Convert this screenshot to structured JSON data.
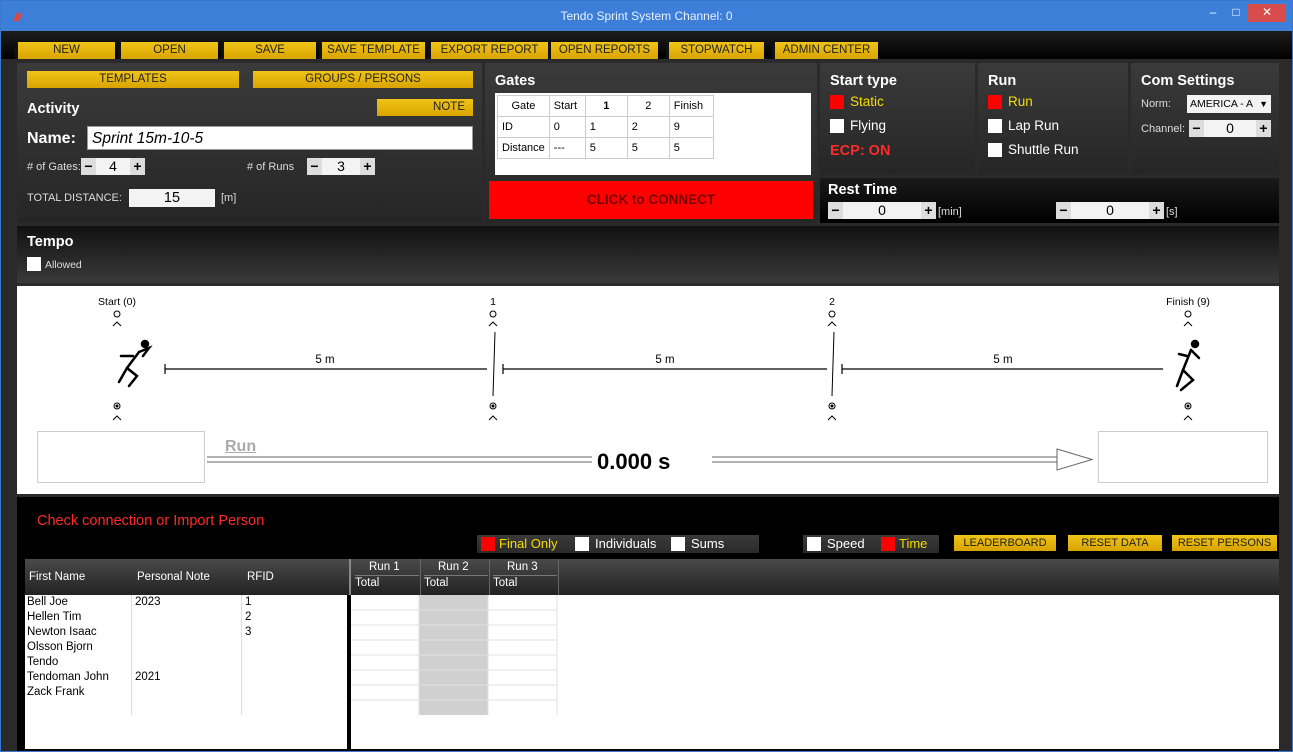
{
  "window": {
    "title": "Tendo Sprint System Channel: 0",
    "min_glyph": "–",
    "max_glyph": "□",
    "close_glyph": "✕"
  },
  "menu": [
    "NEW",
    "OPEN",
    "SAVE",
    "SAVE TEMPLATE",
    "EXPORT REPORT",
    "OPEN REPORTS",
    "STOPWATCH",
    "ADMIN CENTER"
  ],
  "activity": {
    "templates_label": "TEMPLATES",
    "groups_label": "GROUPS / PERSONS",
    "heading": "Activity",
    "note_label": "NOTE",
    "name_label": "Name:",
    "name_value": "Sprint 15m-10-5",
    "gates_label": "# of Gates:",
    "gates_value": "4",
    "runs_label": "# of Runs",
    "runs_value": "3",
    "total_distance_label": "TOTAL DISTANCE:",
    "total_distance_value": "15",
    "total_distance_unit": "[m]",
    "minus": "−",
    "plus": "+"
  },
  "gates": {
    "heading": "Gates",
    "header": [
      "Gate",
      "Start",
      "1",
      "2",
      "Finish"
    ],
    "rows": [
      [
        "ID",
        "0",
        "1",
        "2",
        "9"
      ],
      [
        "Distance",
        "---",
        "5",
        "5",
        "5"
      ]
    ],
    "connect_label": "CLICK to CONNECT"
  },
  "start_type": {
    "heading": "Start type",
    "options": [
      "Static",
      "Flying"
    ],
    "selected": "Static",
    "ecp": "ECP: ON"
  },
  "run": {
    "heading": "Run",
    "options": [
      "Run",
      "Lap Run",
      "Shuttle Run"
    ],
    "selected": "Run"
  },
  "com": {
    "heading": "Com Settings",
    "norm_label": "Norm:",
    "norm_value": "AMERICA - A",
    "channel_label": "Channel:",
    "channel_value": "0"
  },
  "rest": {
    "heading": "Rest Time",
    "min_value": "0",
    "min_unit": "[min]",
    "sec_value": "0",
    "sec_unit": "[s]"
  },
  "tempo": {
    "heading": "Tempo",
    "allowed_label": "Allowed"
  },
  "track": {
    "gates": [
      "Start (0)",
      "1",
      "2",
      "Finish (9)"
    ],
    "distances": [
      "5 m",
      "5 m",
      "5 m"
    ],
    "run_label": "Run",
    "time": "0.000 s"
  },
  "bottom": {
    "status": "Check connection or Import Person",
    "filters": [
      "Final Only",
      "Individuals",
      "Sums"
    ],
    "filter_selected": "Final Only",
    "metrics": [
      "Speed",
      "Time"
    ],
    "metric_selected": "Time",
    "buttons": [
      "LEADERBOARD",
      "RESET DATA",
      "RESET PERSONS"
    ],
    "columns": [
      "First Name",
      "Personal Note",
      "RFID"
    ],
    "runs": [
      {
        "label": "Run 1",
        "sub": "Total"
      },
      {
        "label": "Run 2",
        "sub": "Total"
      },
      {
        "label": "Run 3",
        "sub": "Total"
      }
    ],
    "persons": [
      {
        "name": "Bell Joe",
        "note": "2023",
        "rfid": "1"
      },
      {
        "name": "Hellen Tim",
        "note": "",
        "rfid": "2"
      },
      {
        "name": "Newton Isaac",
        "note": "",
        "rfid": "3"
      },
      {
        "name": "Olsson Bjorn",
        "note": "",
        "rfid": ""
      },
      {
        "name": "Tendo",
        "note": "",
        "rfid": ""
      },
      {
        "name": "Tendoman John",
        "note": "2021",
        "rfid": ""
      },
      {
        "name": "Zack Frank",
        "note": "",
        "rfid": ""
      }
    ]
  },
  "colors": {
    "accent_yellow": "#f0c419",
    "connect_red": "#ff0000",
    "status_red": "#ff2a2a",
    "titlebar_blue": "#3d7fd8"
  }
}
